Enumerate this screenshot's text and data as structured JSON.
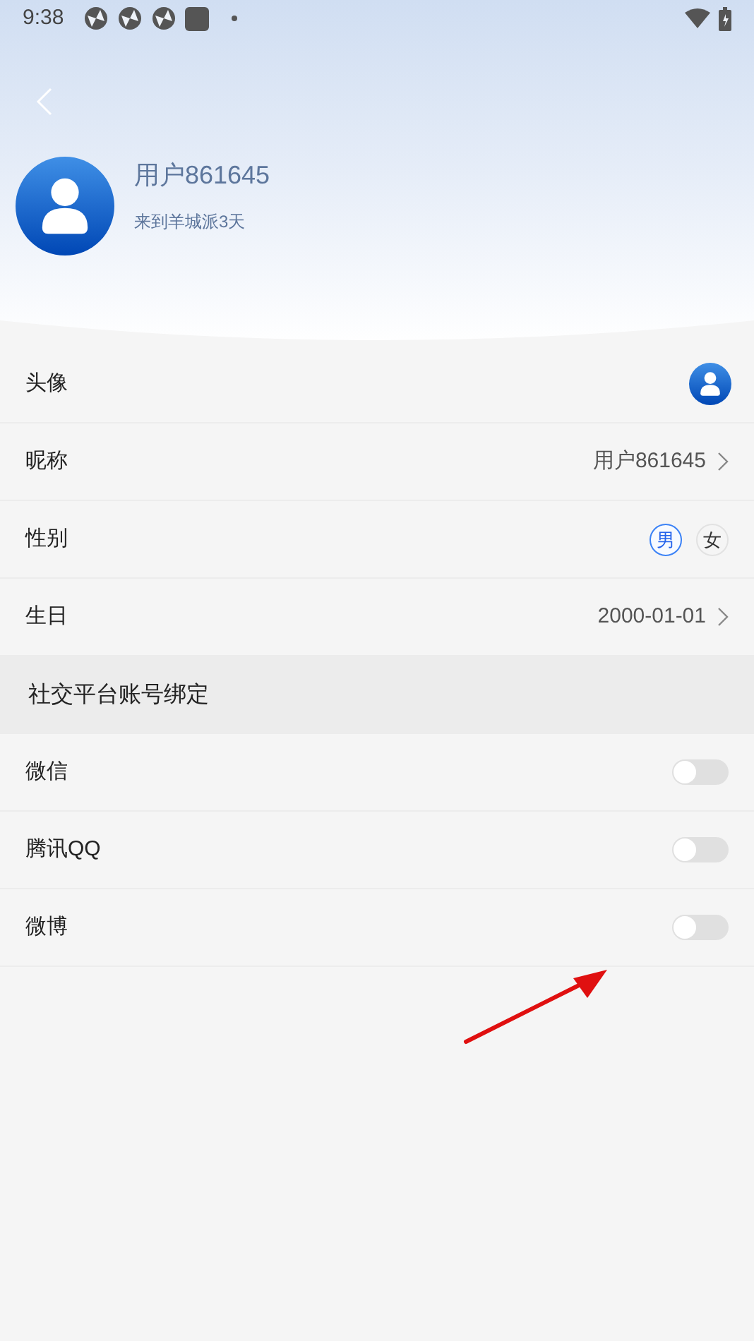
{
  "status_bar": {
    "time": "9:38"
  },
  "profile": {
    "name": "用户861645",
    "subtitle": "来到羊城派3天"
  },
  "rows": [
    {
      "kind": "avatar",
      "label": "头像"
    },
    {
      "kind": "value",
      "label": "昵称",
      "value": "用户861645"
    },
    {
      "kind": "gender",
      "label": "性别",
      "options": [
        {
          "label": "男",
          "selected": true
        },
        {
          "label": "女",
          "selected": false
        }
      ]
    },
    {
      "kind": "value",
      "label": "生日",
      "value": "2000-01-01"
    }
  ],
  "section": {
    "title": "社交平台账号绑定"
  },
  "bindings": [
    {
      "label": "微信",
      "on": false
    },
    {
      "label": "腾讯QQ",
      "on": false
    },
    {
      "label": "微博",
      "on": false
    }
  ]
}
